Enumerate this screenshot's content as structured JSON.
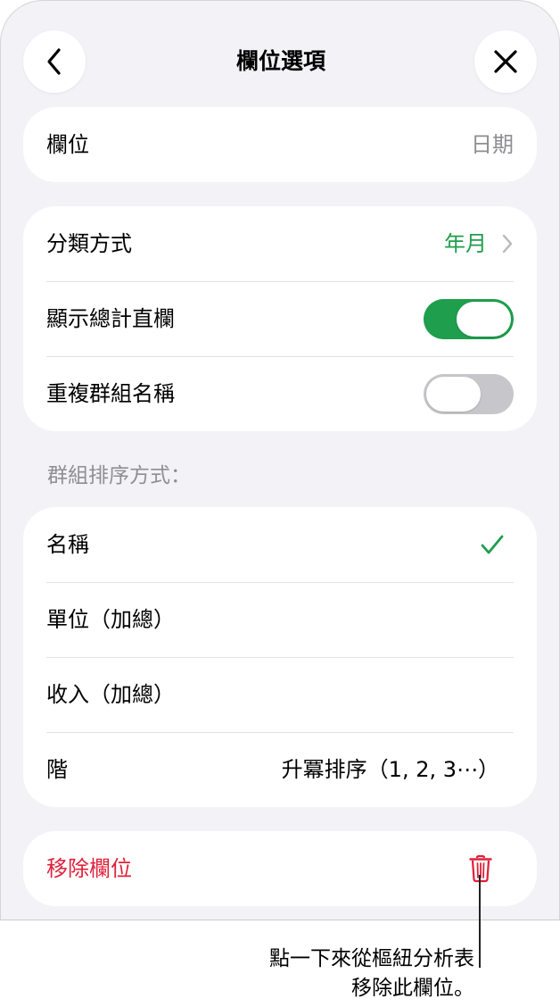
{
  "header": {
    "title": "欄位選項",
    "back_icon": "chevron-left-icon",
    "close_icon": "close-icon"
  },
  "field_group": {
    "label": "欄位",
    "value": "日期"
  },
  "options_group": {
    "sort_by_label": "分類方式",
    "sort_by_value": "年月",
    "show_totals_label": "顯示總計直欄",
    "show_totals_on": true,
    "repeat_names_label": "重複群組名稱",
    "repeat_names_on": false
  },
  "sort_section": {
    "header": "群組排序方式：",
    "items": [
      {
        "label": "名稱",
        "value": "",
        "checked": true
      },
      {
        "label": "單位（加總）",
        "value": "",
        "checked": false
      },
      {
        "label": "收入（加總）",
        "value": "",
        "checked": false
      },
      {
        "label": "階",
        "value": "升冪排序（1, 2, 3⋯）",
        "checked": false
      }
    ]
  },
  "remove": {
    "label": "移除欄位",
    "icon": "trash-icon"
  },
  "callout": {
    "line1": "點一下來從樞紐分析表",
    "line2": "移除此欄位。"
  },
  "colors": {
    "accent_green": "#1f9e4d",
    "destructive_red": "#e0203a",
    "background": "#f2f2f7"
  }
}
